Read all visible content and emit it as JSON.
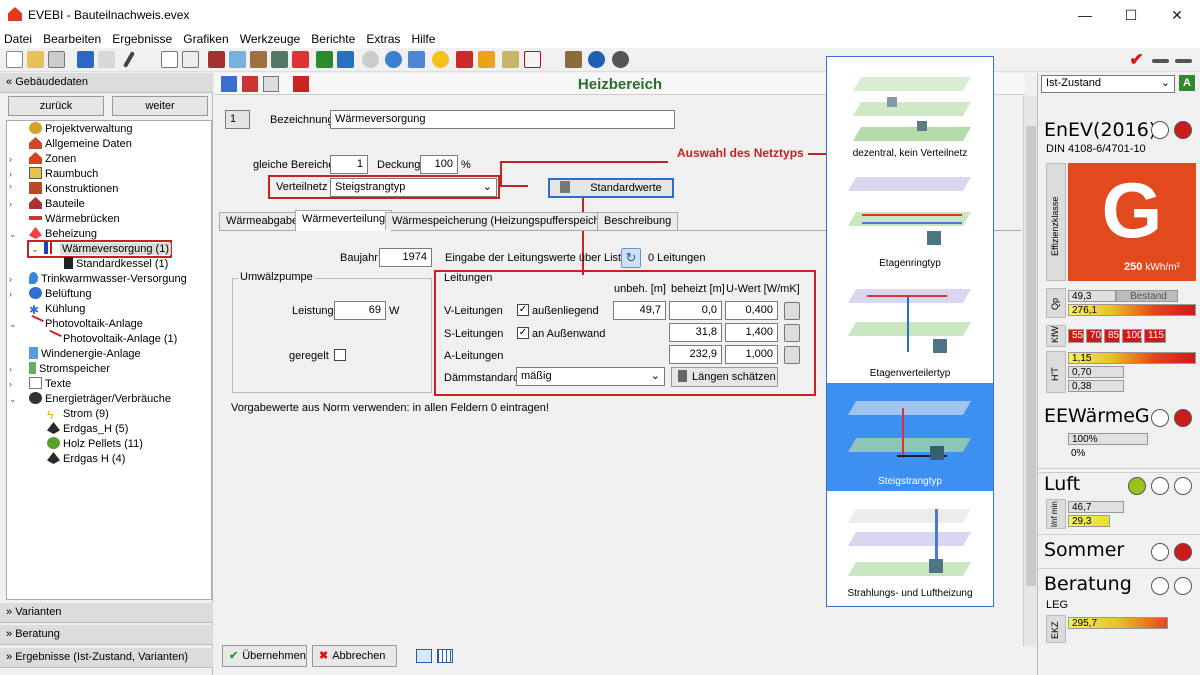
{
  "window": {
    "title": "EVEBI - Bauteilnachweis.evex"
  },
  "menu": [
    "Datei",
    "Bearbeiten",
    "Ergebnisse",
    "Grafiken",
    "Werkzeuge",
    "Berichte",
    "Extras",
    "Hilfe"
  ],
  "left": {
    "header": "Gebäudedaten",
    "back": "zurück",
    "forward": "weiter",
    "tree": [
      {
        "label": "Projektverwaltung"
      },
      {
        "label": "Allgemeine Daten"
      },
      {
        "label": "Zonen"
      },
      {
        "label": "Raumbuch"
      },
      {
        "label": "Konstruktionen"
      },
      {
        "label": "Bauteile"
      },
      {
        "label": "Wärmebrücken"
      },
      {
        "label": "Beheizung"
      },
      {
        "label": "Wärmeversorgung (1)"
      },
      {
        "label": "Standardkessel (1)"
      },
      {
        "label": "Trinkwarmwasser-Versorgung"
      },
      {
        "label": "Belüftung"
      },
      {
        "label": "Kühlung"
      },
      {
        "label": "Photovoltaik-Anlage"
      },
      {
        "label": "Photovoltaik-Anlage (1)"
      },
      {
        "label": "Windenergie-Anlage"
      },
      {
        "label": "Stromspeicher"
      },
      {
        "label": "Texte"
      },
      {
        "label": "Energieträger/Verbräuche"
      },
      {
        "label": "Strom (9)"
      },
      {
        "label": "Erdgas_H (5)"
      },
      {
        "label": "Holz Pellets (11)"
      },
      {
        "label": "Erdgas H (4)"
      }
    ],
    "bottom": [
      "Varianten",
      "Beratung",
      "Ergebnisse (Ist-Zustand, Varianten)"
    ]
  },
  "main": {
    "title": "Heizbereich",
    "index": "1",
    "bezeichnung_label": "Bezeichnung",
    "bezeichnung": "Wärmeversorgung",
    "gleiche_label": "gleiche Bereiche",
    "gleiche": "1",
    "deckung_label": "Deckung",
    "deckung": "100",
    "deckung_unit": "%",
    "verteilnetz_label": "Verteilnetz",
    "verteilnetz": "Steigstrangtyp",
    "standardwerte": "Standardwerte",
    "annotation": "Auswahl des Netztyps",
    "tabs": [
      "Wärmeabgabe",
      "Wärmeverteilung",
      "Wärmespeicherung (Heizungspufferspeicher)",
      "Beschreibung"
    ],
    "baujahr_label": "Baujahr",
    "baujahr": "1974",
    "eingabe_label": "Eingabe der Leitungswerte über Liste:",
    "leitungen_count": "0 Leitungen",
    "umwaelz": {
      "title": "Umwälzpumpe",
      "leistung_label": "Leistung",
      "leistung": "69",
      "unit": "W",
      "geregelt": "geregelt"
    },
    "leitungen": {
      "title": "Leitungen",
      "headers": [
        "unbeh. [m]",
        "beheizt [m]",
        "U-Wert [W/mK]"
      ],
      "rows": [
        {
          "label": "V-Leitungen",
          "check": "außenliegend",
          "unbeh": "49,7",
          "beheizt": "0,0",
          "u": "0,400"
        },
        {
          "label": "S-Leitungen",
          "check": "an Außenwand",
          "unbeh": "",
          "beheizt": "31,8",
          "u": "1,400"
        },
        {
          "label": "A-Leitungen",
          "check": "",
          "unbeh": "",
          "beheizt": "232,9",
          "u": "1,000"
        }
      ],
      "daemm_label": "Dämmstandard",
      "daemm": "mäßig",
      "laengen": "Längen schätzen"
    },
    "hint": "Vorgabewerte aus Norm verwenden: in allen Feldern 0 eintragen!",
    "ok": "Übernehmen",
    "cancel": "Abbrechen"
  },
  "popup": [
    "dezentral, kein Verteilnetz",
    "Etagenringtyp",
    "Etagenverteilertyp",
    "Steigstrangtyp",
    "Strahlungs- und Luftheizung"
  ],
  "right": {
    "state": "Ist-Zustand",
    "enev": "EnEV(2016)",
    "din": "DIN 4108-6/4701-10",
    "effizienz_label": "Effizienzklasse",
    "klasse": "G",
    "kwh": "250",
    "kwh_unit": "kWh/m²",
    "qp_label": "Qp",
    "qp1": "49,3",
    "bestand": "Bestand",
    "qp2": "276,1",
    "kfw_label": "KfW",
    "kfw": [
      "55",
      "70",
      "85",
      "100",
      "115"
    ],
    "ht_label": "H'T",
    "ht": [
      "1,15",
      "0,70",
      "0,38"
    ],
    "eewg": "EEWärmeG",
    "ee": [
      "100%",
      "0%"
    ],
    "luft": "Luft",
    "luft_label": "l/nf min",
    "luft_vals": [
      "46,7",
      "29,3"
    ],
    "sommer": "Sommer",
    "beratung": "Beratung",
    "leg": "LEG",
    "ekz_label": "EKZ",
    "ekz": "295,7",
    "colors": {
      "red": "#cc1b1b",
      "green": "#99c21a",
      "orange": "#e24a1d"
    }
  }
}
